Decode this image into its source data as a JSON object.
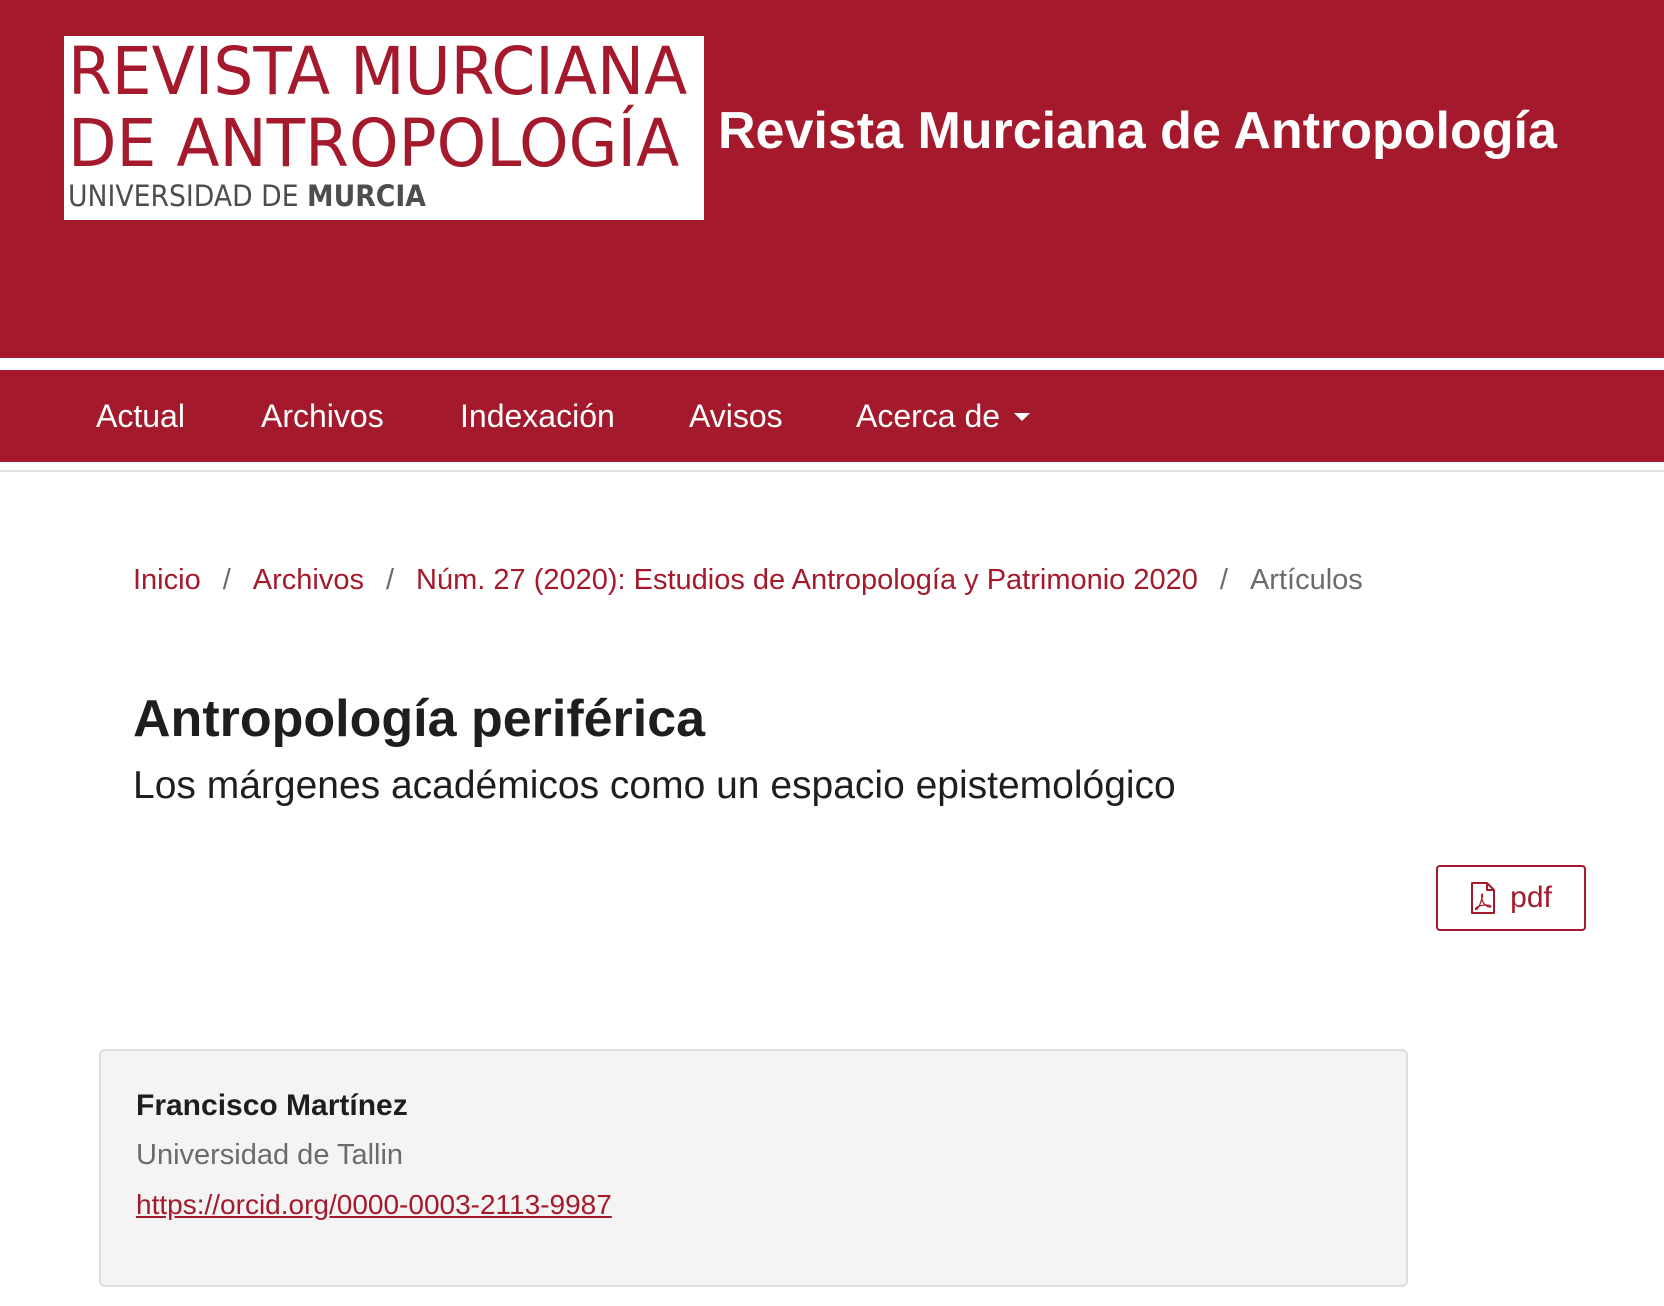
{
  "header": {
    "logo": {
      "line1": "REVISTA MURCIANA",
      "line2": "DE ANTROPOLOGÍA",
      "line3_prefix": "UNIVERSIDAD DE ",
      "line3_bold": "MURCIA"
    },
    "site_title": "Revista Murciana de Antropología"
  },
  "nav": {
    "items": [
      {
        "label": "Actual"
      },
      {
        "label": "Archivos"
      },
      {
        "label": "Indexación"
      },
      {
        "label": "Avisos"
      },
      {
        "label": "Acerca de",
        "icon": "caret-down-icon"
      }
    ]
  },
  "breadcrumb": {
    "items": [
      {
        "label": "Inicio"
      },
      {
        "label": "Archivos"
      },
      {
        "label": "Núm. 27 (2020): Estudios de Antropología y Patrimonio 2020"
      }
    ],
    "separator": "/",
    "current": "Artículos"
  },
  "article": {
    "title": "Antropología periférica",
    "subtitle": "Los márgenes académicos como un espacio epistemológico",
    "pdf_label": "pdf",
    "pdf_icon": "file-pdf-icon"
  },
  "author": {
    "name": "Francisco Martínez",
    "affiliation": "Universidad de Tallin",
    "orcid": "https://orcid.org/0000-0003-2113-9987"
  },
  "colors": {
    "brand": "#a5192c",
    "text": "#1e1e1e",
    "muted": "#6b6b6b",
    "author_box_bg": "#f4f4f4"
  }
}
